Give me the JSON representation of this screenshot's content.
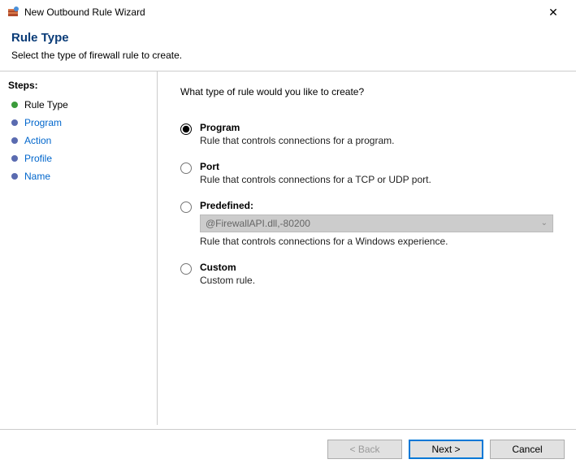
{
  "window": {
    "title": "New Outbound Rule Wizard",
    "close_glyph": "✕"
  },
  "header": {
    "title": "Rule Type",
    "subtitle": "Select the type of firewall rule to create."
  },
  "sidebar": {
    "steps_label": "Steps:",
    "items": [
      {
        "label": "Rule Type",
        "current": true
      },
      {
        "label": "Program",
        "current": false
      },
      {
        "label": "Action",
        "current": false
      },
      {
        "label": "Profile",
        "current": false
      },
      {
        "label": "Name",
        "current": false
      }
    ]
  },
  "main": {
    "question": "What type of rule would you like to create?",
    "options": {
      "program": {
        "label": "Program",
        "desc": "Rule that controls connections for a program.",
        "selected": true
      },
      "port": {
        "label": "Port",
        "desc": "Rule that controls connections for a TCP or UDP port.",
        "selected": false
      },
      "predefined": {
        "label": "Predefined:",
        "combo_value": "@FirewallAPI.dll,-80200",
        "desc": "Rule that controls connections for a Windows experience.",
        "selected": false
      },
      "custom": {
        "label": "Custom",
        "desc": "Custom rule.",
        "selected": false
      }
    }
  },
  "footer": {
    "back": "< Back",
    "next": "Next >",
    "cancel": "Cancel"
  }
}
